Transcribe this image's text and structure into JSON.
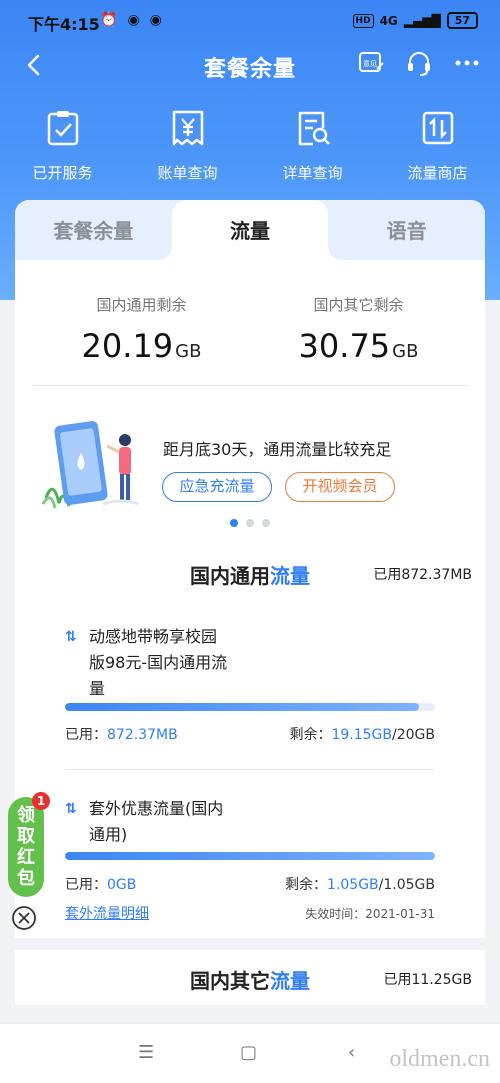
{
  "status": {
    "time": "下午4:15",
    "network": "4G",
    "battery": "57",
    "hd": "HD"
  },
  "nav": {
    "title": "套餐余量",
    "feedback_label": "意见"
  },
  "shortcuts": [
    {
      "label": "已开服务",
      "icon": "clipboard-check-icon"
    },
    {
      "label": "账单查询",
      "icon": "yuan-bill-icon"
    },
    {
      "label": "详单查询",
      "icon": "detail-search-icon"
    },
    {
      "label": "流量商店",
      "icon": "data-store-icon"
    }
  ],
  "tabs": [
    "套餐余量",
    "流量",
    "语音"
  ],
  "active_tab": 1,
  "remaining": {
    "general_label": "国内通用剩余",
    "general_value": "20.19",
    "general_unit": "GB",
    "other_label": "国内其它剩余",
    "other_value": "30.75",
    "other_unit": "GB"
  },
  "promo": {
    "tip": "距月底30天，通用流量比较充足",
    "btn_emergency": "应急充流量",
    "btn_video": "开视频会员",
    "dots": 3,
    "active_dot": 0
  },
  "section_general": {
    "title_prefix": "国内通用",
    "title_highlight": "流量",
    "used": "已用872.37MB"
  },
  "packages": [
    {
      "name_lines": [
        "动感地带畅享校园",
        "版98元-国内通用流",
        "量"
      ],
      "used_label": "已用：",
      "used_value": "872.37MB",
      "remain_label": "剩余：",
      "remain_value": "19.15GB",
      "remain_total": "/20GB",
      "remaining_fraction": 0.9575
    },
    {
      "name_lines": [
        "套外优惠流量(国内",
        "通用)"
      ],
      "used_label": "已用：",
      "used_value": "0GB",
      "remain_label": "剩余：",
      "remain_value": "1.05GB",
      "remain_total": "/1.05GB",
      "remaining_fraction": 1.0,
      "detail_link": "套外流量明细",
      "expire": "失效时间：2021-01-31"
    }
  ],
  "section_other": {
    "title_prefix": "国内其它",
    "title_highlight": "流量",
    "used": "已用11.25GB"
  },
  "red_envelope": {
    "label_lines": [
      "领",
      "取",
      "红",
      "包"
    ],
    "badge": "1"
  },
  "watermark": "oldmen.cn",
  "colors": {
    "primary": "#2f7ef5",
    "header_gradient_top": "#3c86f5",
    "orange": "#f07a3a",
    "envelope_green": "#63c04a"
  }
}
